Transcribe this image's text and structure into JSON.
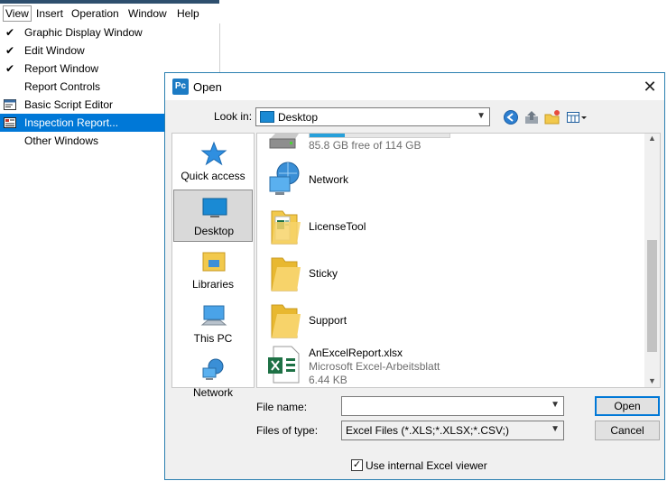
{
  "menubar": {
    "items": [
      "View",
      "Insert",
      "Operation",
      "Window",
      "Help"
    ]
  },
  "view_menu": {
    "items": [
      {
        "label": "Graphic Display Window",
        "checked": true
      },
      {
        "label": "Edit Window",
        "checked": true
      },
      {
        "label": "Report Window",
        "checked": true
      },
      {
        "label": "Report Controls",
        "checked": false
      },
      {
        "label": "Basic Script Editor",
        "icon": "script-editor-icon"
      },
      {
        "label": "Inspection Report...",
        "icon": "inspection-report-icon",
        "highlighted": true
      },
      {
        "label": "Other Windows",
        "checked": false
      }
    ],
    "checkmark": "✔"
  },
  "dialog": {
    "app_icon_text": "Pc",
    "title": "Open",
    "close_glyph": "✕",
    "look_in_label": "Look in:",
    "look_in_value": "Desktop",
    "places": [
      "Quick access",
      "Desktop",
      "Libraries",
      "This PC",
      "Network"
    ],
    "selected_place": "Desktop",
    "files": [
      {
        "name": "",
        "sub": "85.8 GB free of 114 GB",
        "icon": "drive-icon",
        "usage": 0.25
      },
      {
        "name": "Network",
        "icon": "network-icon"
      },
      {
        "name": "LicenseTool",
        "icon": "folder-excel-icon"
      },
      {
        "name": "Sticky",
        "icon": "folder-icon"
      },
      {
        "name": "Support",
        "icon": "folder-icon"
      },
      {
        "name": "AnExcelReport.xlsx",
        "sub": "Microsoft Excel-Arbeitsblatt",
        "sub2": "6.44 KB",
        "icon": "excel-file-icon"
      }
    ],
    "file_name_label": "File name:",
    "file_name_value": "",
    "files_of_type_label": "Files of type:",
    "files_of_type_value": "Excel Files (*.XLS;*.XLSX;*.CSV;)",
    "open_button": "Open",
    "cancel_button": "Cancel",
    "internal_viewer_label": "Use internal Excel viewer",
    "internal_viewer_checked": true,
    "check_glyph": "✓"
  },
  "colors": {
    "accent": "#0078d7",
    "title_border": "#2a7fb0",
    "folder": "#f2c94c",
    "excel": "#1e7145"
  }
}
